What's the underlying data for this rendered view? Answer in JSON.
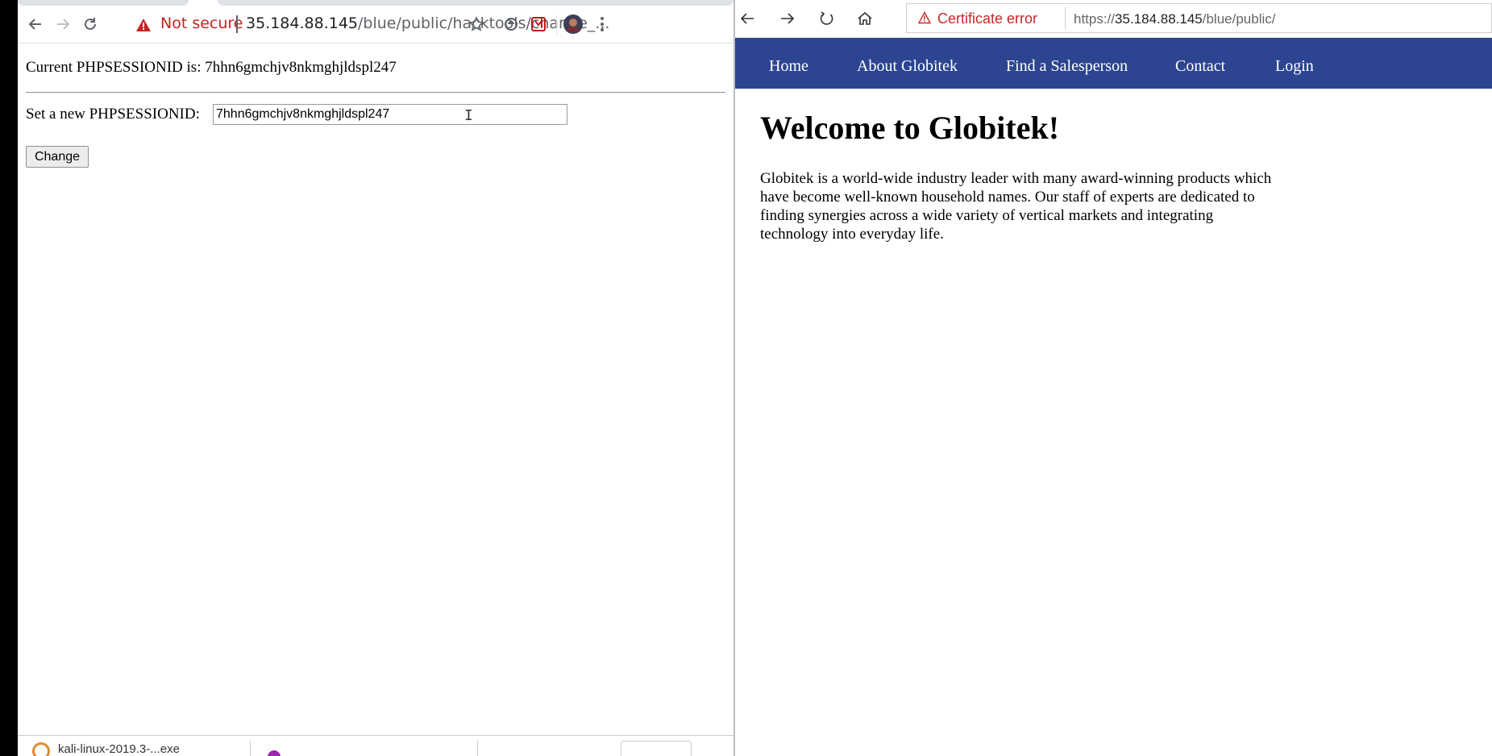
{
  "chrome": {
    "security_label": "Not secure",
    "url_host": "35.184.88.145",
    "url_path": "/blue/public/hacktools/change_..."
  },
  "session_page": {
    "current_label": "Current PHPSESSIONID is:",
    "current_value": "7hhn6gmchjv8nkmghjldspl247",
    "set_label": "Set a new PHPSESSIONID:",
    "input_value": "7hhn6gmchjv8nkmghjldspl247",
    "change_button": "Change"
  },
  "download_shelf": {
    "item_name": "kali-linux-2019.3-...exe"
  },
  "ie": {
    "cert_label": "Certificate error",
    "url_prefix": "https://",
    "url_host": "35.184.88.145",
    "url_path": "/blue/public/"
  },
  "site": {
    "nav": [
      "Home",
      "About Globitek",
      "Find a Salesperson",
      "Contact",
      "Login"
    ],
    "heading": "Welcome to Globitek!",
    "intro": "Globitek is a world-wide industry leader with many award-winning products which have become well-known household names. Our staff of experts are dedicated to finding synergies across a wide variety of vertical markets and integrating technology into everyday life.",
    "nav_color": "#2d4590"
  }
}
